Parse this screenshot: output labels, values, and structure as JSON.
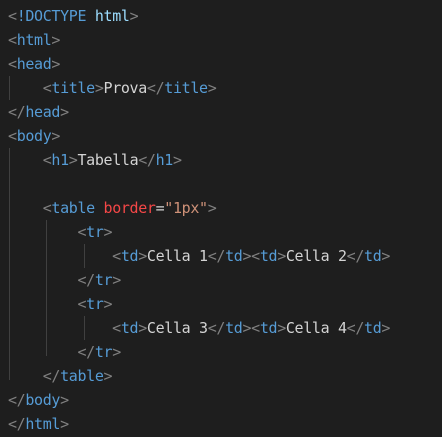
{
  "editor": {
    "background": "#1e1e1e",
    "colors": {
      "bracket": "#808080",
      "tag": "#569cd6",
      "attribute": "#f44747",
      "string": "#ce9178",
      "text": "#d4d4d4"
    },
    "lines": [
      {
        "doctype_kw": "!DOCTYPE",
        "doctype_name": "html"
      },
      {
        "open_tag": "html"
      },
      {
        "open_tag": "head"
      },
      {
        "open_tag": "title",
        "text": "Prova",
        "close_tag": "title"
      },
      {
        "close_tag": "head"
      },
      {
        "open_tag": "body"
      },
      {
        "open_tag": "h1",
        "text": "Tabella",
        "close_tag": "h1"
      },
      {},
      {
        "open_tag": "table",
        "attr_name": "border",
        "attr_value": "\"1px\""
      },
      {
        "open_tag": "tr"
      },
      {
        "td1_open": "td",
        "td1_text": "Cella 1",
        "td1_close": "td",
        "td2_open": "td",
        "td2_text": "Cella 2",
        "td2_close": "td"
      },
      {
        "close_tag": "tr"
      },
      {
        "open_tag": "tr"
      },
      {
        "td1_open": "td",
        "td1_text": "Cella 3",
        "td1_close": "td",
        "td2_open": "td",
        "td2_text": "Cella 4",
        "td2_close": "td"
      },
      {
        "close_tag": "tr"
      },
      {
        "close_tag": "table"
      },
      {
        "close_tag": "body"
      },
      {
        "close_tag": "html"
      }
    ]
  }
}
